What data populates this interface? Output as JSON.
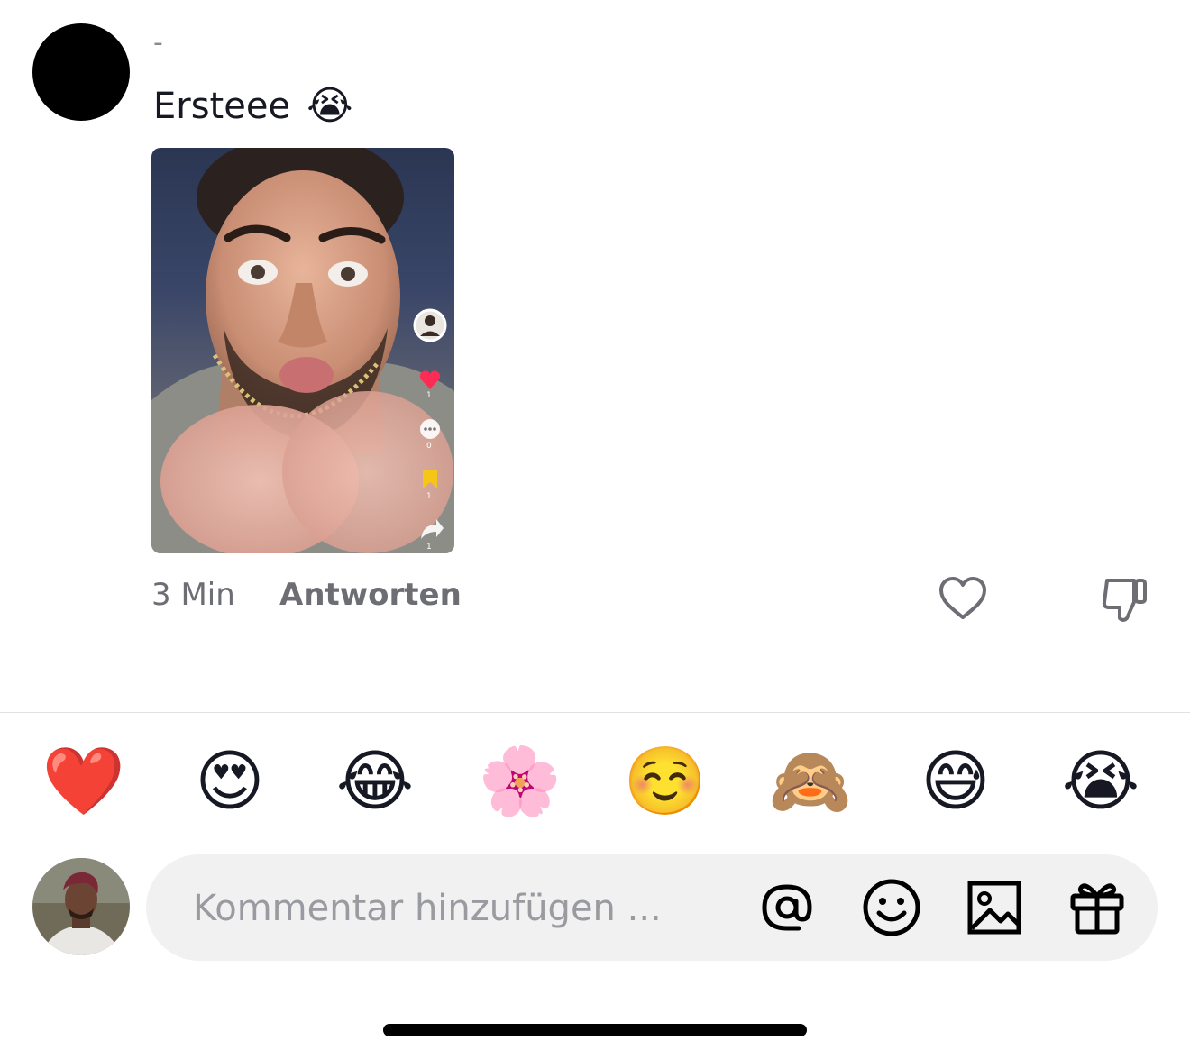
{
  "comment": {
    "username": "-",
    "text": "Ersteee",
    "emoji": "😭",
    "time": "3 Min",
    "reply_label": "Antworten"
  },
  "video": {
    "side_icons": [
      "profile-icon",
      "heart-icon",
      "comment-icon",
      "bookmark-icon",
      "share-icon"
    ],
    "counts": [
      "1",
      "0",
      "1",
      "1"
    ]
  },
  "quick_emojis": [
    "❤️",
    "😍",
    "😂",
    "🌸",
    "☺️",
    "🙈",
    "😅",
    "😭"
  ],
  "composer": {
    "placeholder": "Kommentar hinzufügen ...",
    "tools": [
      "at-icon",
      "emoji-icon",
      "image-icon",
      "gift-icon"
    ]
  },
  "colors": {
    "background": "#ffffff",
    "input_bg": "#f1f1f2",
    "muted_text": "#6d6e74",
    "like_red": "#fe2c55"
  }
}
